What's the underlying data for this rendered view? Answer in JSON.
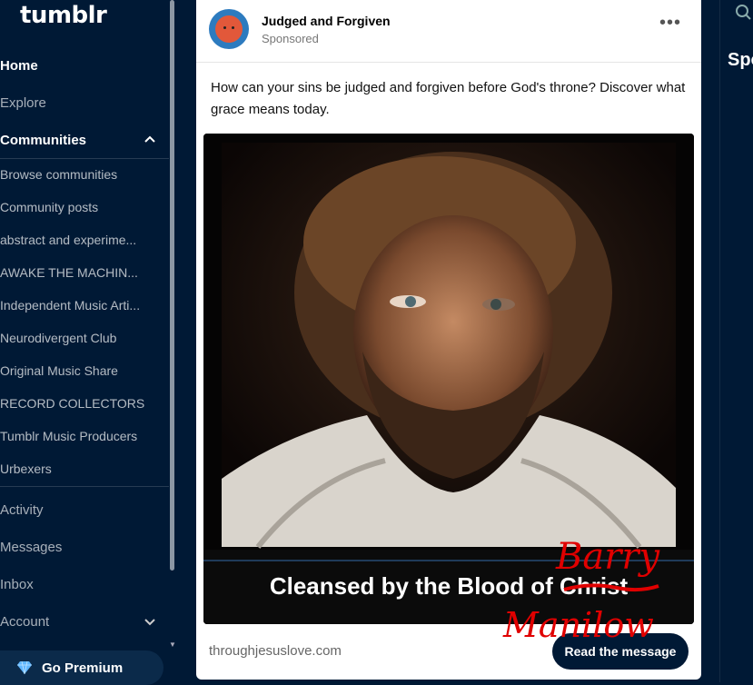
{
  "app": {
    "logo": "tumblr"
  },
  "sidebar": {
    "nav": [
      {
        "label": "Home"
      },
      {
        "label": "Explore"
      },
      {
        "label": "Communities"
      }
    ],
    "communities": [
      {
        "label": "Browse communities"
      },
      {
        "label": "Community posts"
      },
      {
        "label": "abstract and experime..."
      },
      {
        "label": "AWAKE THE MACHIN..."
      },
      {
        "label": "Independent Music Arti..."
      },
      {
        "label": "Neurodivergent Club"
      },
      {
        "label": "Original Music Share"
      },
      {
        "label": "RECORD COLLECTORS"
      },
      {
        "label": "Tumblr Music Producers"
      },
      {
        "label": "Urbexers"
      }
    ],
    "bottom_nav": [
      {
        "label": "Activity"
      },
      {
        "label": "Messages"
      },
      {
        "label": "Inbox"
      },
      {
        "label": "Account"
      }
    ],
    "premium_label": "Go Premium"
  },
  "post": {
    "blog_name": "Judged and Forgiven",
    "sponsored_label": "Sponsored",
    "more_icon": "more-options-icon",
    "body_text": "How can your sins be judged and forgiven before God's throne? Discover what grace means today.",
    "image_caption": "Cleansed by the Blood of Christ",
    "scribble_top": "Barry",
    "scribble_bottom": "Manilow",
    "link_domain": "throughjesuslove.com",
    "cta_label": "Read the message"
  },
  "right_panel": {
    "heading": "Spo"
  },
  "colors": {
    "background": "#001935",
    "card": "#ffffff",
    "accent_red": "#e00000",
    "avatar_blue": "#2d7bbf",
    "avatar_orange": "#e2583a"
  }
}
